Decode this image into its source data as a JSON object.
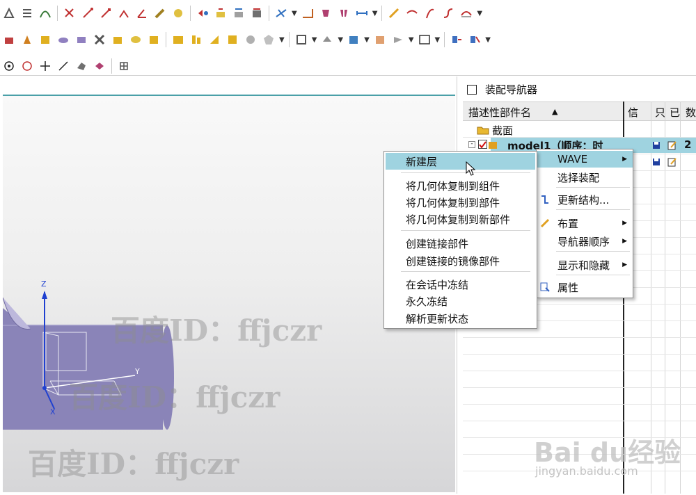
{
  "navigator": {
    "title": "装配导航器",
    "columns": [
      "描述性部件名",
      "信",
      "只",
      "已",
      "数"
    ],
    "sort_arrow": "▲",
    "rows": [
      {
        "label": "截面"
      },
      {
        "label": "model1（顺序：时",
        "count": "2"
      }
    ]
  },
  "context_menu": {
    "items": [
      {
        "label": "WAVE",
        "has_submenu": true
      },
      {
        "label": "选择装配"
      },
      {
        "label": "更新结构..."
      },
      {
        "label": "布置",
        "has_submenu": true
      },
      {
        "label": "导航器顺序",
        "has_submenu": true
      },
      {
        "label": "显示和隐藏",
        "has_submenu": true
      },
      {
        "label": "属性"
      }
    ]
  },
  "wave_submenu": {
    "items": [
      {
        "label": "新建层",
        "highlighted": true
      },
      {
        "label": "将几何体复制到组件"
      },
      {
        "label": "将几何体复制到部件"
      },
      {
        "label": "将几何体复制到新部件"
      },
      {
        "label": "创建链接部件"
      },
      {
        "label": "创建链接的镜像部件"
      },
      {
        "label": "在会话中冻结"
      },
      {
        "label": "永久冻结"
      },
      {
        "label": "解析更新状态"
      }
    ]
  },
  "csys": {
    "z": "Z",
    "y": "Y",
    "x": "X"
  },
  "watermarks": {
    "text": "百度ID：ffjczr",
    "brand": "Bai du经验",
    "url": "jingyan.baidu.com"
  },
  "colors": {
    "selection": "#9fd3e0",
    "solid": "#8a84b8",
    "accent_line": "#4aa0a8"
  }
}
